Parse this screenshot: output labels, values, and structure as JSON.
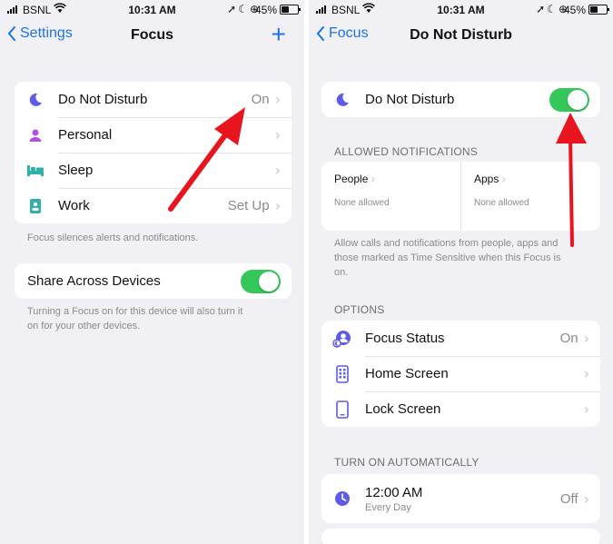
{
  "status": {
    "carrier": "BSNL",
    "time": "10:31 AM",
    "battery": "45%"
  },
  "left": {
    "nav": {
      "back_label": "Settings",
      "title": "Focus",
      "add_label": "+"
    },
    "focus_modes": [
      {
        "label": "Do Not Disturb",
        "value": "On",
        "icon": "moon-icon",
        "color": "#5e5ce6"
      },
      {
        "label": "Personal",
        "value": "",
        "icon": "person-icon",
        "color": "#af52de"
      },
      {
        "label": "Sleep",
        "value": "",
        "icon": "bed-icon",
        "color": "#30b0a8"
      },
      {
        "label": "Work",
        "value": "Set Up",
        "icon": "badge-icon",
        "color": "#30b0a8"
      }
    ],
    "focus_footer": "Focus silences alerts and notifications.",
    "share": {
      "label": "Share Across Devices",
      "enabled": true
    },
    "share_footer_line1": "Turning a Focus on for this device will also turn it",
    "share_footer_line2": "on for your other devices."
  },
  "right": {
    "nav": {
      "back_label": "Focus",
      "title": "Do Not Disturb"
    },
    "dnd": {
      "label": "Do Not Disturb",
      "enabled": true
    },
    "allowed_header": "ALLOWED NOTIFICATIONS",
    "people": {
      "title": "People",
      "sub": "None allowed"
    },
    "apps": {
      "title": "Apps",
      "sub": "None allowed"
    },
    "allowed_footer_line1": "Allow calls and notifications from people, apps and",
    "allowed_footer_line2": "those marked as Time Sensitive when this Focus is",
    "allowed_footer_line3": "on.",
    "options_header": "OPTIONS",
    "options": [
      {
        "label": "Focus Status",
        "value": "On",
        "icon": "focus-status-icon"
      },
      {
        "label": "Home Screen",
        "value": "",
        "icon": "home-screen-icon"
      },
      {
        "label": "Lock Screen",
        "value": "",
        "icon": "lock-screen-icon"
      }
    ],
    "auto_header": "TURN ON AUTOMATICALLY",
    "schedule": {
      "time": "12:00 AM",
      "repeat": "Every Day",
      "value": "Off"
    }
  },
  "colors": {
    "accent": "#1a73e8",
    "toggle_on": "#34c759",
    "arrow": "#e8141e",
    "moon": "#5e5ce6"
  }
}
